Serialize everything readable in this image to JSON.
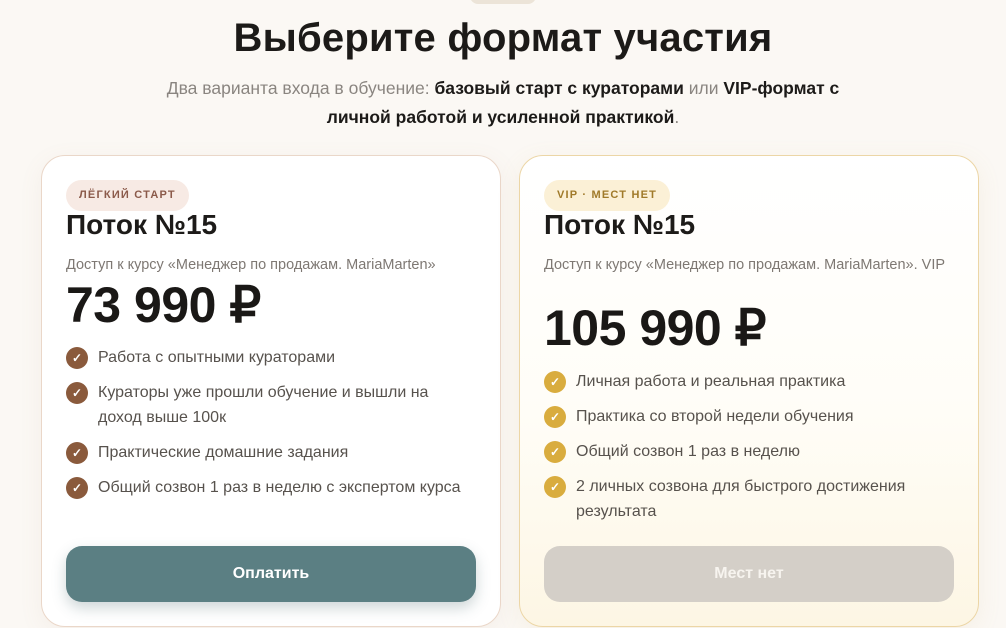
{
  "header": {
    "title": "Выберите формат участия",
    "subtitle_parts": {
      "p1": "Два варианта входа в обучение: ",
      "b1": "базовый старт с кураторами",
      "p2": " или ",
      "b2": "VIP-формат с личной работой и усиленной практикой",
      "p3": "."
    }
  },
  "plans": [
    {
      "badge": "ЛЁГКИЙ СТАРТ",
      "title": "Поток №15",
      "description": "Доступ к курсу «Менеджер по продажам. MariaMarten»",
      "price": "73 990 ₽",
      "features": [
        "Работа с опытными кураторами",
        "Кураторы уже прошли обучение и вышли на доход выше 100к",
        "Практические домашние задания",
        "Общий созвон 1 раз в неделю с экспертом курса"
      ],
      "button_label": "Оплатить"
    },
    {
      "badge": "VIP · МЕСТ НЕТ",
      "title": "Поток №15",
      "description": "Доступ к курсу «Менеджер по продажам. MariaMarten». VIP",
      "price": "105 990 ₽",
      "features": [
        "Личная работа и реальная практика",
        "Практика со второй недели обучения",
        "Общий созвон 1 раз в неделю",
        "2 личных созвона для быстрого достижения результата"
      ],
      "button_label": "Мест нет"
    }
  ],
  "icons": {
    "feature_check": "check-circle-icon"
  },
  "colors": {
    "pay_button": "#5b7f83",
    "disabled_button": "#d4cfc8",
    "check_basic": "#8a5a3c",
    "check_vip": "#d9ac3e",
    "page_background": "#fbf8f4"
  }
}
